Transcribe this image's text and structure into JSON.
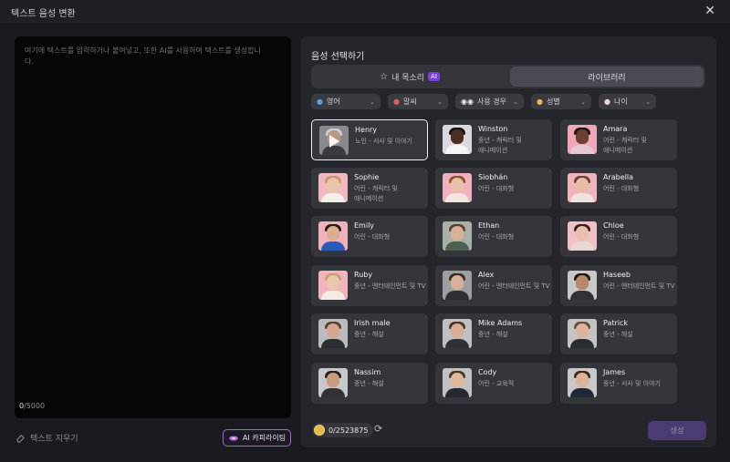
{
  "window": {
    "title": "텍스트 음성 변환",
    "close_icon": "close-icon"
  },
  "editor": {
    "placeholder": "여기에 텍스트를 입력하거나 붙여넣고, 또한 AI를 사용하여 텍스트를 생성합니다.",
    "char_count": "0",
    "char_limit": "/5000"
  },
  "footer_left": {
    "clear_label": "텍스트 지우기",
    "ai_label": "AI 카피라이팅"
  },
  "panel": {
    "title": "음성 선택하기",
    "tabs": [
      {
        "label": "내 목소리",
        "badge": "AI",
        "icon": "star-icon"
      },
      {
        "label": "라이브러리"
      }
    ],
    "filters": [
      {
        "label": "영어",
        "icon": "globe-icon"
      },
      {
        "label": "말씨",
        "icon": "flag-icon"
      },
      {
        "label": "사용 경우",
        "icon": "eyes-icon"
      },
      {
        "label": "성별",
        "icon": "person-icon"
      },
      {
        "label": "나이",
        "icon": "cake-icon"
      }
    ],
    "voices": [
      {
        "name": "Henry",
        "desc": "노인 - 서사 및 이야기",
        "selected": true
      },
      {
        "name": "Winston",
        "desc": "중년 - 캐릭터 및 애니메이션"
      },
      {
        "name": "Amara",
        "desc": "어린 - 캐릭터 및 애니메이션"
      },
      {
        "name": "Sophie",
        "desc": "어린 - 캐릭터 및 애니메이션"
      },
      {
        "name": "Siobhán",
        "desc": "어린 - 대화형"
      },
      {
        "name": "Arabella",
        "desc": "어린 - 대화형"
      },
      {
        "name": "Emily",
        "desc": "어린 - 대화형"
      },
      {
        "name": "Ethan",
        "desc": "어린 - 대화형"
      },
      {
        "name": "Chloe",
        "desc": "어린 - 대화형"
      },
      {
        "name": "Ruby",
        "desc": "중년 - 엔터테인먼트 및 TV"
      },
      {
        "name": "Alex",
        "desc": "어린 - 엔터테인먼트 및 TV"
      },
      {
        "name": "Haseeb",
        "desc": "어린 - 엔터테인먼트 및 TV"
      },
      {
        "name": "Irish male",
        "desc": "중년 - 해설"
      },
      {
        "name": "Mike Adams",
        "desc": "중년 - 해설"
      },
      {
        "name": "Patrick",
        "desc": "중년 - 해설"
      },
      {
        "name": "Nassim",
        "desc": "중년 - 해설"
      },
      {
        "name": "Cody",
        "desc": "어린 - 교육적"
      },
      {
        "name": "James",
        "desc": "중년 - 서사 및 이야기"
      }
    ],
    "credits": "0/2523875",
    "generate_label": "생성"
  },
  "colors": {
    "accent": "#7b3fe0",
    "ai_border": "#b05de0",
    "generate_bg": "#4b3b73"
  }
}
